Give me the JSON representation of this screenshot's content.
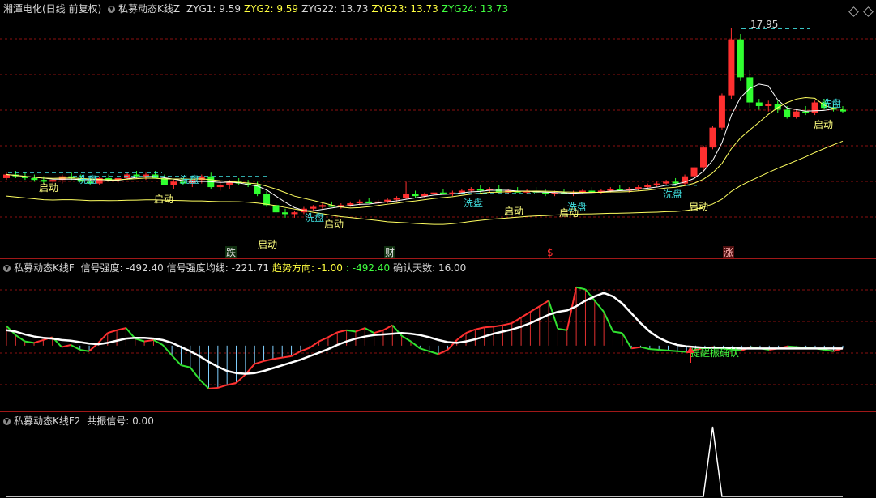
{
  "panel1": {
    "stock_title": "湘潭电化(日线 前复权)",
    "indicator_name": "私募动态K线Z",
    "values": [
      {
        "label": "ZYG1: 9.59",
        "color": "#d8d8d8"
      },
      {
        "label": "ZYG2: 9.59",
        "color": "#ffff40"
      },
      {
        "label": "ZYG22: 13.73",
        "color": "#d8d8d8"
      },
      {
        "label": "ZYG23: 13.73",
        "color": "#ffff40"
      },
      {
        "label": "ZYG24: 13.73",
        "color": "#40ff40"
      }
    ],
    "peak_label": "17.95",
    "xi_label": "洗盘",
    "qi_label": "启动",
    "markers": [
      "跌",
      "财",
      "$",
      "涨"
    ]
  },
  "panel2": {
    "indicator_name": "私募动态K线F",
    "items": [
      {
        "label": "信号强度: -492.40",
        "color": "#d8d8d8"
      },
      {
        "label": "信号强度均线: -221.71",
        "color": "#d8d8d8"
      },
      {
        "label": "趋势方向: -1.00",
        "color": "#ffff40"
      },
      {
        "label": ": -492.40",
        "color": "#40ff40"
      },
      {
        "label": "确认天数: 16.00",
        "color": "#d8d8d8"
      }
    ],
    "annotation": "提醒振确认"
  },
  "panel3": {
    "indicator_name": "私募动态K线F2",
    "items": [
      {
        "label": "共振信号: 0.00",
        "color": "#d8d8d8"
      }
    ]
  },
  "colors": {
    "up": "#ff3030",
    "down": "#30ff30",
    "line_main": "#ffffff",
    "line_yellow": "#ffff60",
    "dash": "#40e0e0",
    "grid": "#8a1010"
  },
  "chart_data": [
    {
      "type": "candlestick",
      "title": "湘潭电化(日线 前复权)",
      "ylim": [
        6,
        18.5
      ],
      "max_label": 17.95,
      "candles": [
        [
          9.6,
          9.9,
          9.5,
          9.8
        ],
        [
          9.8,
          10.0,
          9.6,
          9.7
        ],
        [
          9.7,
          9.9,
          9.5,
          9.6
        ],
        [
          9.6,
          9.8,
          9.4,
          9.5
        ],
        [
          9.5,
          9.7,
          9.3,
          9.4
        ],
        [
          9.4,
          9.6,
          9.2,
          9.5
        ],
        [
          9.5,
          9.8,
          9.3,
          9.7
        ],
        [
          9.7,
          9.9,
          9.5,
          9.6
        ],
        [
          9.6,
          9.8,
          9.4,
          9.4
        ],
        [
          9.4,
          9.6,
          9.2,
          9.3
        ],
        [
          9.3,
          9.7,
          9.2,
          9.6
        ],
        [
          9.6,
          9.8,
          9.4,
          9.5
        ],
        [
          9.5,
          9.7,
          9.3,
          9.6
        ],
        [
          9.6,
          9.9,
          9.5,
          9.8
        ],
        [
          9.8,
          10.0,
          9.6,
          9.7
        ],
        [
          9.7,
          9.9,
          9.5,
          9.8
        ],
        [
          9.8,
          10.0,
          9.6,
          9.6
        ],
        [
          9.6,
          9.8,
          9.3,
          9.2
        ],
        [
          9.2,
          9.5,
          9.0,
          9.4
        ],
        [
          9.4,
          9.6,
          9.2,
          9.3
        ],
        [
          9.3,
          9.5,
          9.1,
          9.5
        ],
        [
          9.5,
          9.8,
          9.3,
          9.7
        ],
        [
          9.7,
          9.9,
          9.0,
          9.1
        ],
        [
          9.1,
          9.4,
          8.9,
          9.2
        ],
        [
          9.2,
          9.5,
          9.0,
          9.4
        ],
        [
          9.4,
          9.6,
          9.2,
          9.3
        ],
        [
          9.3,
          9.5,
          9.1,
          9.2
        ],
        [
          9.2,
          9.4,
          8.6,
          8.7
        ],
        [
          8.7,
          8.9,
          8.0,
          8.1
        ],
        [
          8.1,
          8.3,
          7.6,
          7.7
        ],
        [
          7.7,
          7.9,
          7.4,
          7.6
        ],
        [
          7.6,
          7.8,
          7.4,
          7.7
        ],
        [
          7.7,
          8.0,
          7.6,
          7.9
        ],
        [
          7.9,
          8.1,
          7.8,
          8.0
        ],
        [
          8.0,
          8.2,
          7.9,
          8.1
        ],
        [
          8.1,
          8.3,
          8.0,
          8.0
        ],
        [
          8.0,
          8.2,
          7.9,
          8.1
        ],
        [
          8.1,
          8.3,
          8.0,
          8.2
        ],
        [
          8.2,
          8.4,
          8.1,
          8.3
        ],
        [
          8.3,
          8.5,
          8.2,
          8.2
        ],
        [
          8.2,
          8.4,
          8.1,
          8.3
        ],
        [
          8.3,
          8.5,
          8.2,
          8.4
        ],
        [
          8.4,
          8.6,
          8.3,
          8.5
        ],
        [
          8.5,
          9.4,
          8.4,
          8.7
        ],
        [
          8.7,
          8.9,
          8.5,
          8.6
        ],
        [
          8.6,
          8.8,
          8.5,
          8.7
        ],
        [
          8.7,
          8.9,
          8.6,
          8.8
        ],
        [
          8.8,
          9.0,
          8.7,
          8.7
        ],
        [
          8.7,
          8.9,
          8.6,
          8.8
        ],
        [
          8.8,
          9.0,
          8.7,
          8.9
        ],
        [
          8.9,
          9.1,
          8.8,
          9.0
        ],
        [
          9.0,
          9.2,
          8.8,
          8.9
        ],
        [
          8.9,
          9.1,
          8.8,
          9.0
        ],
        [
          9.0,
          9.2,
          8.9,
          8.8
        ],
        [
          8.8,
          9.0,
          8.7,
          8.9
        ],
        [
          8.9,
          9.1,
          8.8,
          8.8
        ],
        [
          8.8,
          9.0,
          8.7,
          8.9
        ],
        [
          8.9,
          9.1,
          8.7,
          8.8
        ],
        [
          8.8,
          9.0,
          8.6,
          8.7
        ],
        [
          8.7,
          8.9,
          8.6,
          8.8
        ],
        [
          8.8,
          9.0,
          8.7,
          8.7
        ],
        [
          8.7,
          8.9,
          8.6,
          8.8
        ],
        [
          8.8,
          9.0,
          8.7,
          8.9
        ],
        [
          8.9,
          9.1,
          8.8,
          8.8
        ],
        [
          8.8,
          9.0,
          8.7,
          8.9
        ],
        [
          8.9,
          9.1,
          8.8,
          9.0
        ],
        [
          9.0,
          9.2,
          8.9,
          8.9
        ],
        [
          8.9,
          9.1,
          8.8,
          9.0
        ],
        [
          9.0,
          9.2,
          8.9,
          9.1
        ],
        [
          9.1,
          9.3,
          9.0,
          9.2
        ],
        [
          9.2,
          9.4,
          9.1,
          9.3
        ],
        [
          9.3,
          9.5,
          9.2,
          9.4
        ],
        [
          9.4,
          9.6,
          9.2,
          9.3
        ],
        [
          9.3,
          9.8,
          9.2,
          9.7
        ],
        [
          9.7,
          10.3,
          9.5,
          10.2
        ],
        [
          10.2,
          11.4,
          10.0,
          11.3
        ],
        [
          11.3,
          12.5,
          11.2,
          12.4
        ],
        [
          12.4,
          14.3,
          12.3,
          14.2
        ],
        [
          14.2,
          17.95,
          14.0,
          17.3
        ],
        [
          17.3,
          17.6,
          15.0,
          15.2
        ],
        [
          15.2,
          15.6,
          13.5,
          13.8
        ],
        [
          13.8,
          14.0,
          13.4,
          13.6
        ],
        [
          13.6,
          13.9,
          13.3,
          13.7
        ],
        [
          13.7,
          13.9,
          13.2,
          13.4
        ],
        [
          13.4,
          13.6,
          12.9,
          13.0
        ],
        [
          13.0,
          13.4,
          12.9,
          13.3
        ],
        [
          13.3,
          13.6,
          13.1,
          13.2
        ],
        [
          13.2,
          13.9,
          13.1,
          13.8
        ],
        [
          13.8,
          14.0,
          13.4,
          13.5
        ],
        [
          13.5,
          13.7,
          13.3,
          13.4
        ],
        [
          13.4,
          13.6,
          13.2,
          13.3
        ]
      ]
    },
    {
      "type": "bar_line",
      "title": "私募动态K线F",
      "ylim": [
        -900,
        1000
      ],
      "series": [
        {
          "name": "信号强度",
          "values": [
            280,
            150,
            60,
            40,
            80,
            120,
            -20,
            10,
            -60,
            -80,
            40,
            180,
            220,
            250,
            100,
            60,
            80,
            10,
            -140,
            -280,
            -310,
            -480,
            -610,
            -600,
            -560,
            -530,
            -410,
            -260,
            -220,
            -190,
            -170,
            -150,
            -80,
            -30,
            60,
            120,
            190,
            220,
            200,
            250,
            180,
            220,
            290,
            140,
            60,
            -40,
            -80,
            -120,
            -60,
            80,
            180,
            230,
            260,
            270,
            290,
            320,
            400,
            480,
            560,
            640,
            240,
            220,
            830,
            800,
            640,
            480,
            200,
            180,
            -40,
            -20,
            -50,
            -60,
            -70,
            -80,
            -90,
            -60,
            -30,
            -20,
            -40,
            -60,
            -70,
            -20,
            -40,
            -60,
            -40,
            -10,
            -20,
            -30,
            -40,
            -60,
            -80,
            -40
          ]
        },
        {
          "name": "信号强度均线",
          "values": [
            220,
            200,
            160,
            130,
            110,
            100,
            80,
            70,
            50,
            30,
            20,
            40,
            70,
            100,
            110,
            110,
            100,
            80,
            40,
            -20,
            -80,
            -150,
            -230,
            -300,
            -360,
            -390,
            -400,
            -390,
            -360,
            -320,
            -280,
            -240,
            -200,
            -150,
            -100,
            -50,
            10,
            60,
            100,
            130,
            150,
            160,
            170,
            180,
            170,
            150,
            120,
            80,
            50,
            40,
            60,
            90,
            130,
            170,
            200,
            230,
            270,
            320,
            380,
            440,
            480,
            500,
            560,
            640,
            700,
            750,
            700,
            600,
            460,
            320,
            200,
            110,
            50,
            10,
            -10,
            -20,
            -30,
            -30,
            -30,
            -35,
            -40,
            -40,
            -40,
            -40,
            -40,
            -40,
            -40,
            -40,
            -40,
            -40,
            -40,
            -40
          ]
        }
      ]
    },
    {
      "type": "line",
      "title": "私募动态K线F2",
      "ylim": [
        0,
        1
      ],
      "series": [
        {
          "name": "共振信号",
          "values": [
            0,
            0,
            0,
            0,
            0,
            0,
            0,
            0,
            0,
            0,
            0,
            0,
            0,
            0,
            0,
            0,
            0,
            0,
            0,
            0,
            0,
            0,
            0,
            0,
            0,
            0,
            0,
            0,
            0,
            0,
            0,
            0,
            0,
            0,
            0,
            0,
            0,
            0,
            0,
            0,
            0,
            0,
            0,
            0,
            0,
            0,
            0,
            0,
            0,
            0,
            0,
            0,
            0,
            0,
            0,
            0,
            0,
            0,
            0,
            0,
            0,
            0,
            0,
            0,
            0,
            0,
            0,
            0,
            0,
            0,
            0,
            0,
            0,
            0,
            0,
            0,
            1,
            0,
            0,
            0,
            0,
            0,
            0,
            0,
            0,
            0,
            0,
            0,
            0,
            0,
            0
          ]
        }
      ]
    }
  ]
}
